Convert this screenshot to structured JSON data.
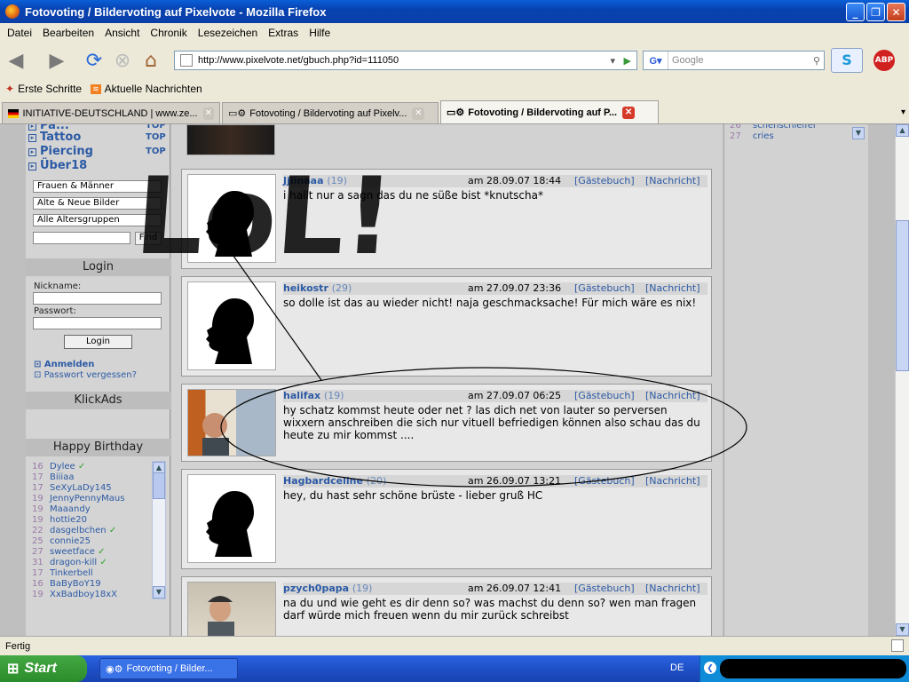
{
  "window": {
    "title": "Fotovoting / Bildervoting auf Pixelvote - Mozilla Firefox"
  },
  "menu": [
    "Datei",
    "Bearbeiten",
    "Ansicht",
    "Chronik",
    "Lesezeichen",
    "Extras",
    "Hilfe"
  ],
  "nav": {
    "url": "http://www.pixelvote.net/gbuch.php?id=111050",
    "search_placeholder": "Google"
  },
  "bookmarks": [
    "Erste Schritte",
    "Aktuelle Nachrichten"
  ],
  "tabs": [
    "INITIATIVE-DEUTSCHLAND | www.ze...",
    "Fotovoting / Bildervoting auf Pixelv...",
    "Fotovoting / Bildervoting auf P..."
  ],
  "sidebar": {
    "categories": [
      {
        "label": "Tattoo",
        "badge": "TOP"
      },
      {
        "label": "Piercing",
        "badge": "TOP"
      },
      {
        "label": "Über18",
        "badge": ""
      }
    ],
    "cat_partial": "Pa...",
    "filters": [
      "Frauen & Männer",
      "Alte & Neue Bilder",
      "Alle Altersgruppen"
    ],
    "find_label": "Find",
    "login": {
      "title": "Login",
      "nick_label": "Nickname:",
      "pass_label": "Passwort:",
      "button": "Login",
      "register": "Anmelden",
      "forgot": "Passwort vergessen?"
    },
    "klickads": "KlickAds",
    "birthday": {
      "title": "Happy Birthday",
      "items": [
        {
          "age": "16",
          "name": "Dylee",
          "check": "✓"
        },
        {
          "age": "17",
          "name": "Biiiaa",
          "check": ""
        },
        {
          "age": "17",
          "name": "SeXyLaDy145",
          "check": ""
        },
        {
          "age": "19",
          "name": "JennyPennyMaus",
          "check": ""
        },
        {
          "age": "19",
          "name": "Maaandy",
          "check": ""
        },
        {
          "age": "19",
          "name": "hottie20",
          "check": ""
        },
        {
          "age": "22",
          "name": "dasgelbchen",
          "check": "✓"
        },
        {
          "age": "25",
          "name": "connie25",
          "check": ""
        },
        {
          "age": "27",
          "name": "sweetface",
          "check": "✓"
        },
        {
          "age": "31",
          "name": "dragon-kill",
          "check": "✓"
        },
        {
          "age": "17",
          "name": "Tinkerbell",
          "check": ""
        },
        {
          "age": "16",
          "name": "BaByBoY19",
          "check": ""
        },
        {
          "age": "19",
          "name": "XxBadboy18xX",
          "check": ""
        }
      ]
    }
  },
  "entries": [
    {
      "user": "Jjiinaaa",
      "age": "(19)",
      "date": "am 28.09.07 18:44",
      "gb": "[Gästebuch]",
      "msg": "[Nachricht]",
      "text": "i hallt nur a sagn das du ne süße bist *knutscha*"
    },
    {
      "user": "heikostr",
      "age": "(29)",
      "date": "am 27.09.07 23:36",
      "gb": "[Gästebuch]",
      "msg": "[Nachricht]",
      "text": "so dolle ist das au wieder nicht! naja geschmacksache! Für mich wäre es nix!"
    },
    {
      "user": "halifax",
      "age": "(19)",
      "date": "am 27.09.07 06:25",
      "gb": "[Gästebuch]",
      "msg": "[Nachricht]",
      "text": "hy schatz kommst heute oder net ? las dich net von lauter so perversen wixxern anschreiben die sich nur vituell befriedigen können also schau das du heute zu mir kommst ...."
    },
    {
      "user": "Hagbardceline",
      "age": "(20)",
      "date": "am 26.09.07 13:21",
      "gb": "[Gästebuch]",
      "msg": "[Nachricht]",
      "text": "hey, du hast sehr schöne brüste - lieber gruß HC"
    },
    {
      "user": "pzych0papa",
      "age": "(19)",
      "date": "am 26.09.07 12:41",
      "gb": "[Gästebuch]",
      "msg": "[Nachricht]",
      "text": "na du und wie geht es dir denn so? was machst du denn so? wen man fragen darf würde mich freuen wenn du mir zurück schreibst"
    }
  ],
  "right": {
    "rows": [
      {
        "age": "26",
        "name": "schenschleifer"
      },
      {
        "age": "27",
        "name": "cries"
      }
    ]
  },
  "status": "Fertig",
  "taskbar": {
    "start": "Start",
    "item": "Fotovoting / Bilder...",
    "lang": "DE"
  },
  "overlay": {
    "lol": "LoL!"
  }
}
